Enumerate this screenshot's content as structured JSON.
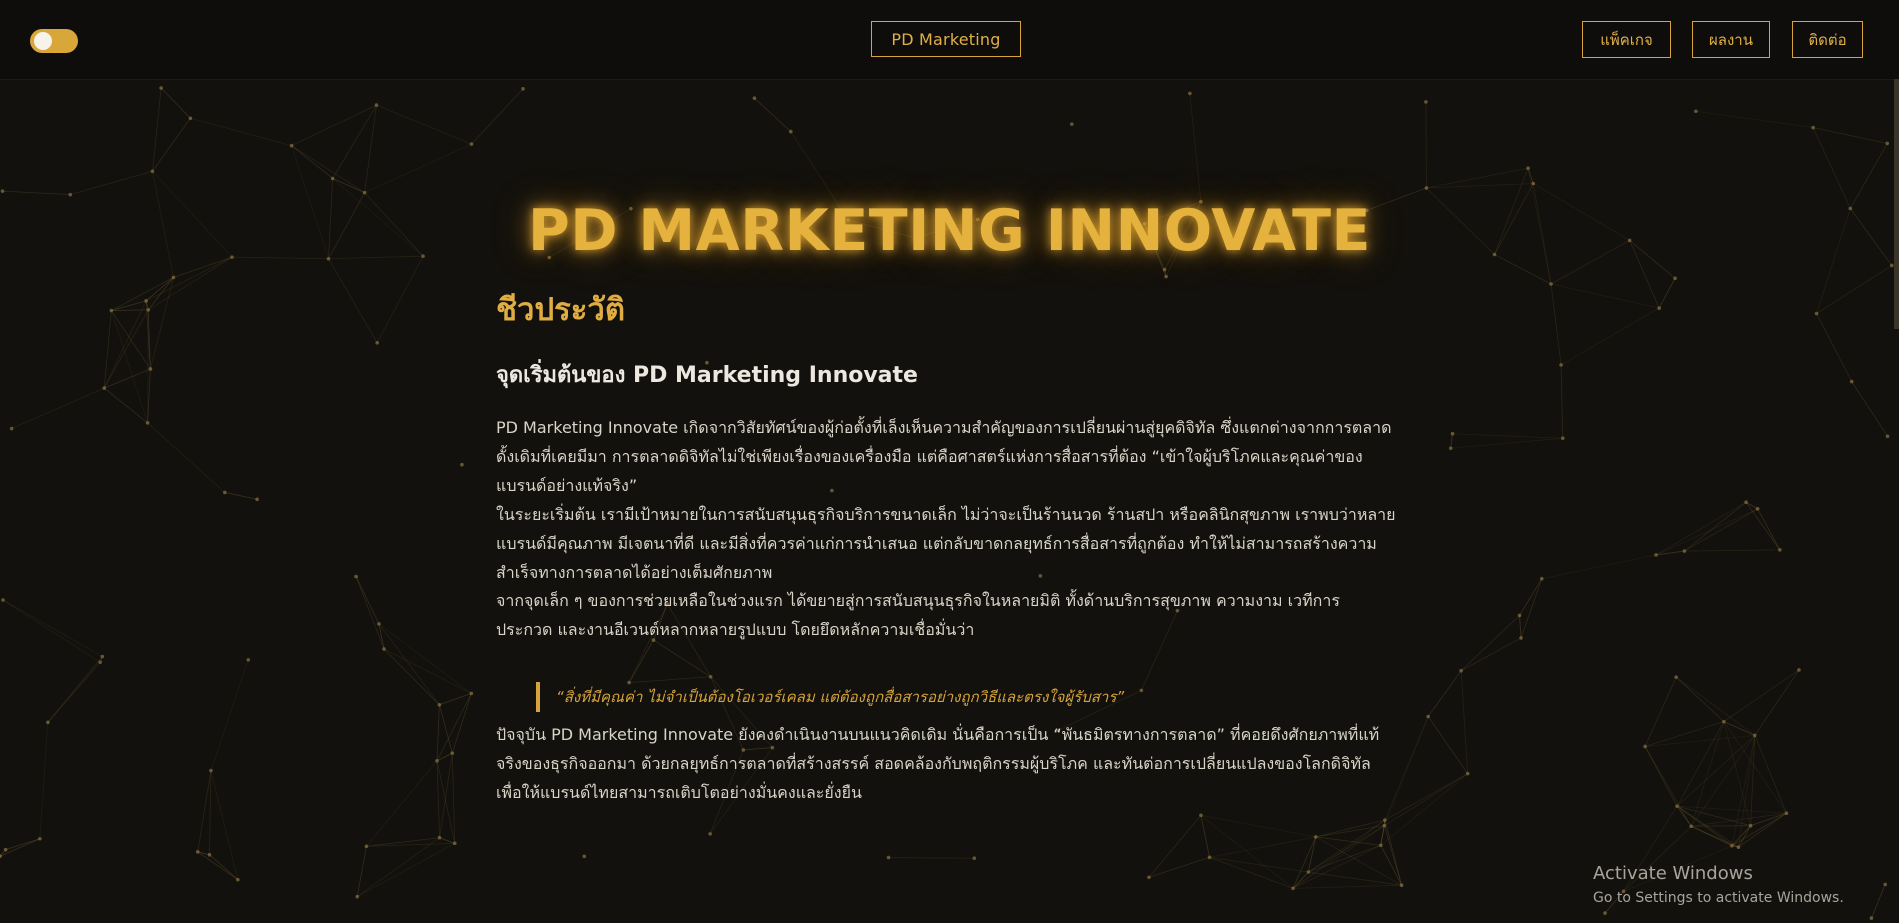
{
  "navbar": {
    "theme_toggle": "on",
    "brand_label": "PD Marketing",
    "buttons": [
      {
        "label": "แพ็คเกจ"
      },
      {
        "label": "ผลงาน"
      },
      {
        "label": "ติดต่อ"
      }
    ]
  },
  "hero": {
    "title": "PD MARKETING INNOVATE"
  },
  "about": {
    "heading": "ชีวประวัติ",
    "subheading": "จุดเริ่มต้นของ PD Marketing Innovate",
    "paragraphs": [
      "PD Marketing Innovate เกิดจากวิสัยทัศน์ของผู้ก่อตั้งที่เล็งเห็นความสำคัญของการเปลี่ยนผ่านสู่ยุคดิจิทัล ซึ่งแตกต่างจากการตลาดดั้งเดิมที่เคยมีมา การตลาดดิจิทัลไม่ใช่เพียงเรื่องของเครื่องมือ แต่คือศาสตร์แห่งการสื่อสารที่ต้อง “เข้าใจผู้บริโภคและคุณค่าของแบรนด์อย่างแท้จริง”",
      "ในระยะเริ่มต้น เรามีเป้าหมายในการสนับสนุนธุรกิจบริการขนาดเล็ก ไม่ว่าจะเป็นร้านนวด ร้านสปา หรือคลินิกสุขภาพ เราพบว่าหลายแบรนด์มีคุณภาพ มีเจตนาที่ดี และมีสิ่งที่ควรค่าแก่การนำเสนอ แต่กลับขาดกลยุทธ์การสื่อสารที่ถูกต้อง ทำให้ไม่สามารถสร้างความสำเร็จทางการตลาดได้อย่างเต็มศักยภาพ",
      "จากจุดเล็ก ๆ ของการช่วยเหลือในช่วงแรก ได้ขยายสู่การสนับสนุนธุรกิจในหลายมิติ ทั้งด้านบริการสุขภาพ ความงาม เวทีการประกวด และงานอีเวนต์หลากหลายรูปแบบ โดยยึดหลักความเชื่อมั่นว่า"
    ],
    "quote": "“สิ่งที่มีคุณค่า ไม่จำเป็นต้องโอเวอร์เคลม แต่ต้องถูกสื่อสารอย่างถูกวิธีและตรงใจผู้รับสาร”",
    "closing": "ปัจจุบัน PD Marketing Innovate ยังคงดำเนินงานบนแนวคิดเดิม นั่นคือการเป็น “พันธมิตรทางการตลาด” ที่คอยดึงศักยภาพที่แท้จริงของธุรกิจออกมา ด้วยกลยุทธ์การตลาดที่สร้างสรรค์ สอดคล้องกับพฤติกรรมผู้บริโภค และทันต่อการเปลี่ยนแปลงของโลกดิจิทัล เพื่อให้แบรนด์ไทยสามารถเติบโตอย่างมั่นคงและยั่งยืน"
  },
  "os_watermark": {
    "title": "Activate Windows",
    "subtitle": "Go to Settings to activate Windows."
  },
  "colors": {
    "background": "#13110d",
    "navbar": "#0e0d0b",
    "accent_gold": "#d7a43b",
    "text": "#d9d4c8",
    "network_lines": "#6b5a34"
  }
}
